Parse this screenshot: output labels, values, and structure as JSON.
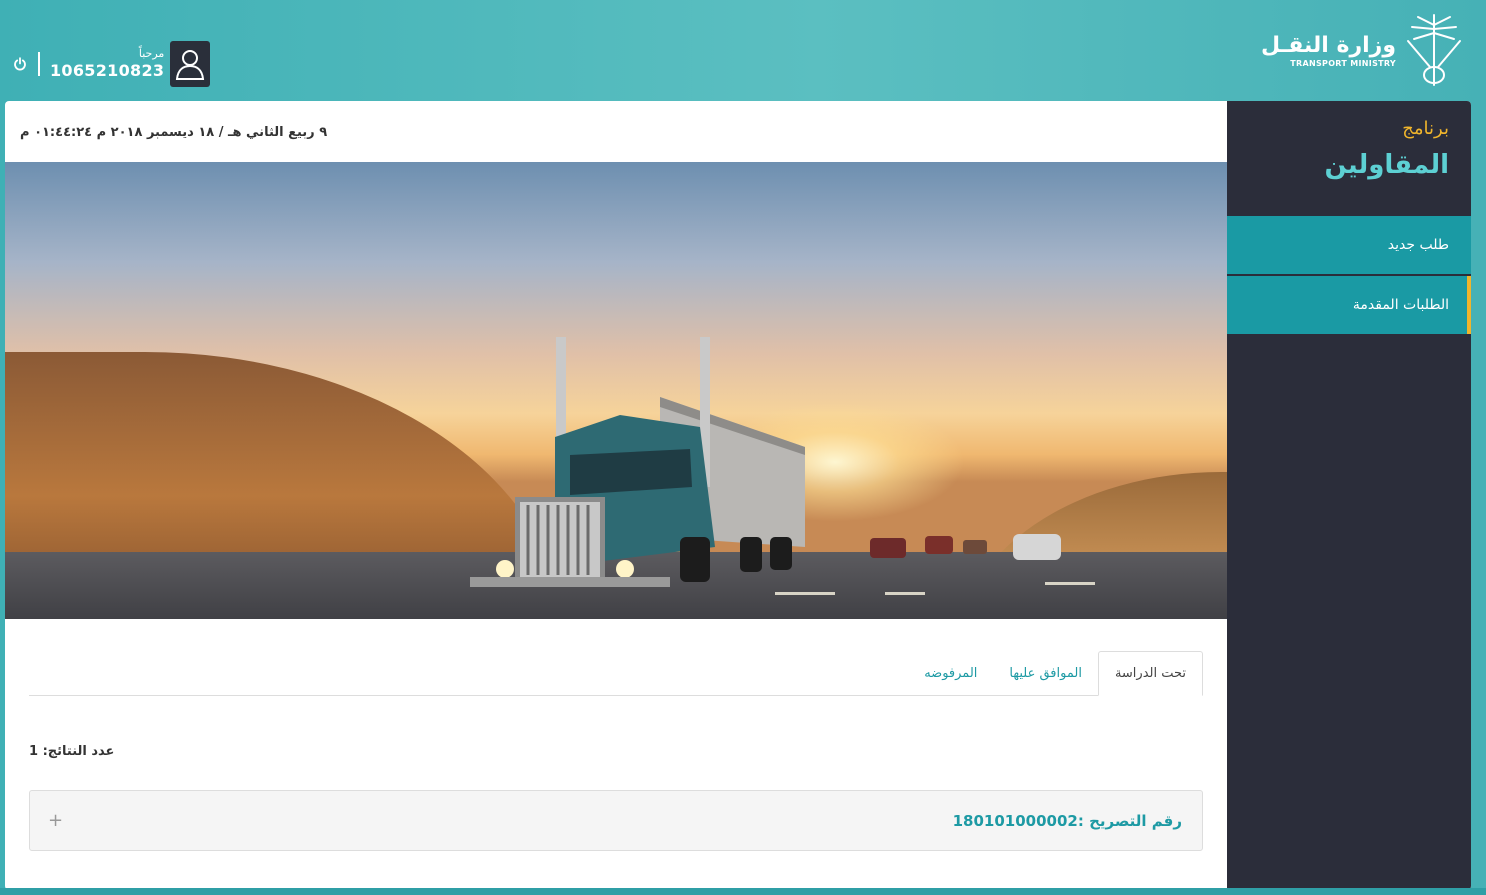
{
  "header": {
    "welcome": "مرحباً",
    "user_id": "1065210823",
    "logo_ar": "وزارة النقـل",
    "logo_en": "TRANSPORT MINISTRY"
  },
  "sidebar": {
    "program_label": "برنامج",
    "title": "المقاولين",
    "items": [
      {
        "label": "طلب جديد"
      },
      {
        "label": "الطلبات المقدمة"
      }
    ]
  },
  "main": {
    "date": "٩ ربيع الثاني هـ / ١٨ ديسمبر ٢٠١٨ م ٠١:٤٤:٢٤ م",
    "tabs": [
      {
        "label": "تحت الدراسة"
      },
      {
        "label": "الموافق عليها"
      },
      {
        "label": "المرفوضه"
      }
    ],
    "results_label": "عدد النتائج: 1",
    "panel_title": "رقم التصريح :180101000002",
    "panel_toggle": "+"
  },
  "colors": {
    "header_bg": "#5bbfc1",
    "sidebar_bg": "#2b2d3a",
    "sidebar_item_bg": "#1a9aa4",
    "accent_yellow": "#f0b52c",
    "accent_teal": "#1d9aa4"
  }
}
